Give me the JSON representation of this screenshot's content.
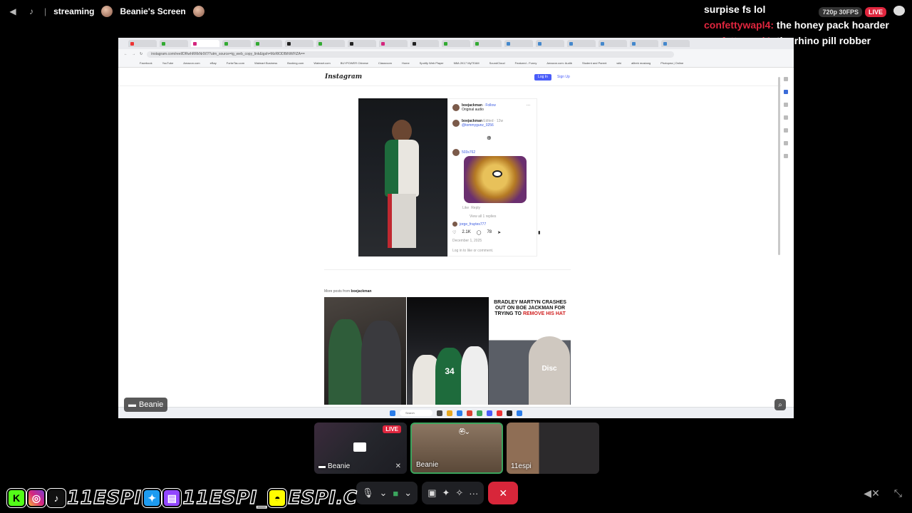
{
  "topbar": {
    "status": "streaming",
    "screen_title": "Beanie's Screen"
  },
  "chat": {
    "messages": [
      {
        "user": "",
        "text": "surpise fs lol"
      },
      {
        "user": "confettywapl4:",
        "text": "the honey pack hoarder"
      },
      {
        "user": "confettywapl4:",
        "text": "the rhino pill robber"
      }
    ],
    "quality": "720p 30FPS",
    "live": "LIVE"
  },
  "browser": {
    "url": "instagram.com/reel/DRwhRRkNr0t7/?utm_source=ig_web_copy_link&igsh=MzRlODBiNWFlZA==",
    "bookmarks": [
      "Facebook",
      "YouTube",
      "Amazon.com",
      "eBay",
      "ForkeTau.com",
      "Walmart Business",
      "Booking.com",
      "Walmart.com",
      "BUYPOWER Chinese",
      "Classroom",
      "Home",
      "Spotify Web Player",
      "NBA 2K17 MyTEAM",
      "SoundCloud",
      "Featured - Funny",
      "Amazon.com: Audib",
      "Student and Parent",
      "wiki",
      "alltrek mustang",
      "Photopea | Online"
    ]
  },
  "instagram": {
    "logo": "Instagram",
    "login": "Log In",
    "signup": "Sign Up",
    "author": "boejackman",
    "follow": "Follow",
    "original_audio": "Original audio",
    "edited": "Edited · 12w",
    "mention": "@tommygunz_0256",
    "commenter1": "503s762",
    "like": "Like",
    "reply": "Reply",
    "view_replies": "View all 1 replies",
    "commenter2": "jorge_fraytes777",
    "likes": "2.1K",
    "comments": "78",
    "date": "December 1, 2025",
    "login_prompt": "Log in to like or comment.",
    "more_posts_prefix": "More posts from",
    "more_posts_user": "boejackman",
    "thumb3_headline_a": "BRADLEY MARTYN CRASHES OUT ON BOE JACKMAN FOR TRYING TO",
    "thumb3_headline_b": "REMOVE HIS HAT",
    "thumb2_jersey": "34",
    "thumb3_cap": "Disc",
    "taskbar_search": "Search"
  },
  "screen_name_tag": "Beanie",
  "participants": [
    {
      "name": "Beanie",
      "badge": "LIVE"
    },
    {
      "name": "Beanie"
    },
    {
      "name": "11espi"
    }
  ],
  "socials_banner": {
    "handle1": "11ESPI",
    "handle2": "11ESPI_",
    "handle3": "ESPI.C"
  }
}
